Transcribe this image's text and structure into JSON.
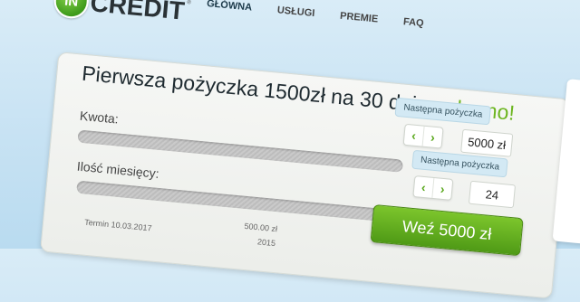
{
  "logo": {
    "badge": "IN",
    "word": "CREDIT",
    "tm": "®"
  },
  "nav": {
    "items": [
      "GŁÓWNA",
      "USŁUGI",
      "PREMIE",
      "FAQ"
    ]
  },
  "hero": {
    "headline": "Pierwsza pożyczka 1500zł na 30 dni ",
    "headline_highlight": "za darmo!"
  },
  "amount": {
    "label": "Kwota:",
    "tooltip": "Następna pożyczka",
    "value": "5000 zł"
  },
  "months": {
    "label": "Ilość miesięcy:",
    "tooltip": "Następna pożyczka",
    "value": "24"
  },
  "cta": {
    "label": "Weź 5000 zł"
  },
  "footer": {
    "term": "Termin 10.03.2017",
    "amount": "500.00 zł",
    "year": "2015"
  },
  "colors": {
    "accent_green": "#6cb51f",
    "button_green": "#5aa81d",
    "background": "#c7e2f3"
  }
}
